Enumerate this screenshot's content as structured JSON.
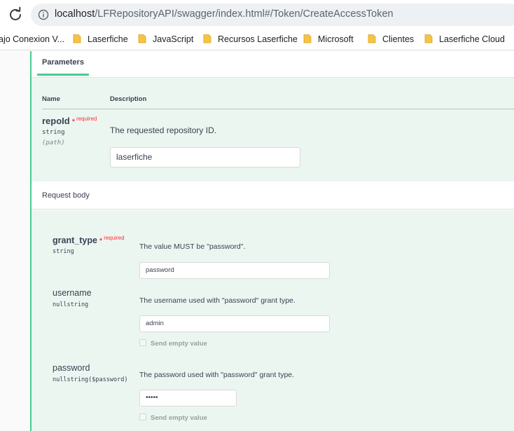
{
  "browser": {
    "url_host": "localhost",
    "url_path": "/LFRepositoryAPI/swagger/index.html#/Token/CreateAccessToken",
    "bookmarks": [
      {
        "label": "ajo Conexion V..."
      },
      {
        "label": "Laserfiche"
      },
      {
        "label": "JavaScript"
      },
      {
        "label": "Recursos Laserfiche"
      },
      {
        "label": "Microsoft"
      },
      {
        "label": "Clientes"
      },
      {
        "label": "Laserfiche Cloud"
      }
    ]
  },
  "parameters": {
    "tab_label": "Parameters",
    "col_name": "Name",
    "col_description": "Description",
    "items": [
      {
        "name": "repoId",
        "required_star": "*",
        "required_label": "required",
        "type": "string",
        "location": "(path)",
        "description": "The requested repository ID.",
        "value": "laserfiche"
      }
    ]
  },
  "request_body": {
    "title": "Request body",
    "fields": [
      {
        "name": "grant_type",
        "required_star": "*",
        "required_label": "required",
        "type": "string",
        "description": "The value MUST be \"password\".",
        "value": "password"
      },
      {
        "name": "username",
        "type": "nullstring",
        "description": "The username used with \"password\" grant type.",
        "value": "admin",
        "send_empty_label": "Send empty value"
      },
      {
        "name": "password",
        "type": "nullstring($password)",
        "description": "The password used with \"password\" grant type.",
        "value": "•••••",
        "send_empty_label": "Send empty value"
      }
    ]
  },
  "colors": {
    "accent_green": "#49cc90",
    "panel_green": "#ebf6f1",
    "text": "#3b4151",
    "required_red": "#ff3030"
  }
}
